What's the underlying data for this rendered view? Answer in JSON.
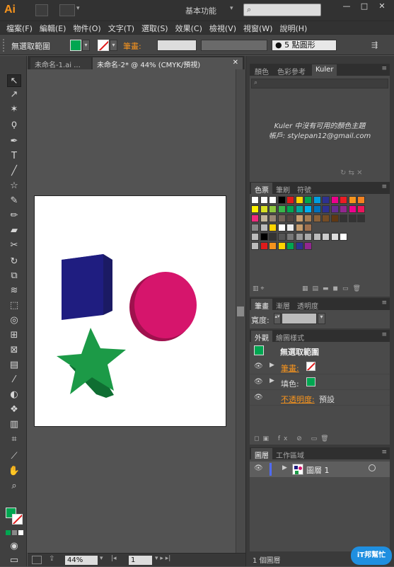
{
  "app": {
    "logo": "Ai",
    "workspace": "基本功能",
    "window_controls": [
      "—",
      "□",
      "✕"
    ]
  },
  "menu": [
    "檔案(F)",
    "編輯(E)",
    "物件(O)",
    "文字(T)",
    "選取(S)",
    "效果(C)",
    "檢視(V)",
    "視窗(W)",
    "說明(H)"
  ],
  "control": {
    "selection": "無選取範圍",
    "stroke_label": "筆畫:",
    "brush": "5 點圓形",
    "fill_color": "#00a651"
  },
  "tabs": {
    "doc1": "未命名-1.ai ...",
    "doc2": "未命名-2* @ 44% (CMYK/預視)"
  },
  "kuler": {
    "tabs": [
      "顏色",
      "色彩參考",
      "Kuler"
    ],
    "message": "Kuler 中沒有可用的顏色主題",
    "account": "帳戶: stylepan12@gmail.com"
  },
  "swatches_panel": {
    "tabs": [
      "色票",
      "筆刷",
      "符號"
    ]
  },
  "stroke_panel": {
    "tabs": [
      "筆畫",
      "漸層",
      "透明度"
    ],
    "weight_label": "寬度:"
  },
  "appearance": {
    "tabs": [
      "外觀",
      "繪圖樣式"
    ],
    "title": "無選取範圍",
    "stroke_label": "筆畫:",
    "fill_label": "填色:",
    "opacity_label": "不透明度:",
    "opacity_value": "預設"
  },
  "layers": {
    "tabs": [
      "圖層",
      "工作區域"
    ],
    "layer_name": "圖層 1",
    "count": "1 個圖層"
  },
  "status": {
    "zoom": "44%",
    "page": "1"
  },
  "watermark": "iT邦幫忙"
}
